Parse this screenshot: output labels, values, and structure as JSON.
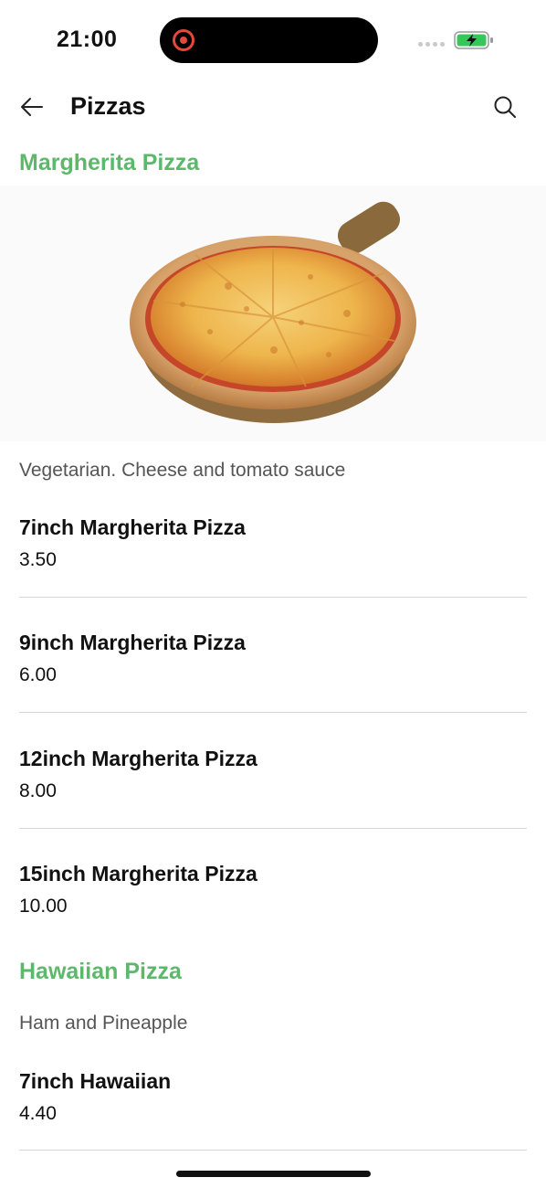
{
  "status": {
    "time": "21:00"
  },
  "header": {
    "title": "Pizzas"
  },
  "sections": [
    {
      "title": "Margherita Pizza",
      "description": "Vegetarian. Cheese and tomato sauce",
      "items": [
        {
          "name": "7inch Margherita Pizza",
          "price": "3.50"
        },
        {
          "name": "9inch Margherita Pizza",
          "price": "6.00"
        },
        {
          "name": "12inch Margherita Pizza",
          "price": "8.00"
        },
        {
          "name": "15inch Margherita Pizza",
          "price": "10.00"
        }
      ]
    },
    {
      "title": "Hawaiian Pizza",
      "description": "Ham and Pineapple",
      "items": [
        {
          "name": "7inch Hawaiian",
          "price": "4.40"
        }
      ]
    }
  ],
  "colors": {
    "accent": "#5cb86a",
    "recording": "#e5483b",
    "battery": "#34c759"
  },
  "icons": {
    "back": "arrow-left-icon",
    "search": "search-icon",
    "recording": "record-icon",
    "battery": "battery-charging-icon"
  }
}
